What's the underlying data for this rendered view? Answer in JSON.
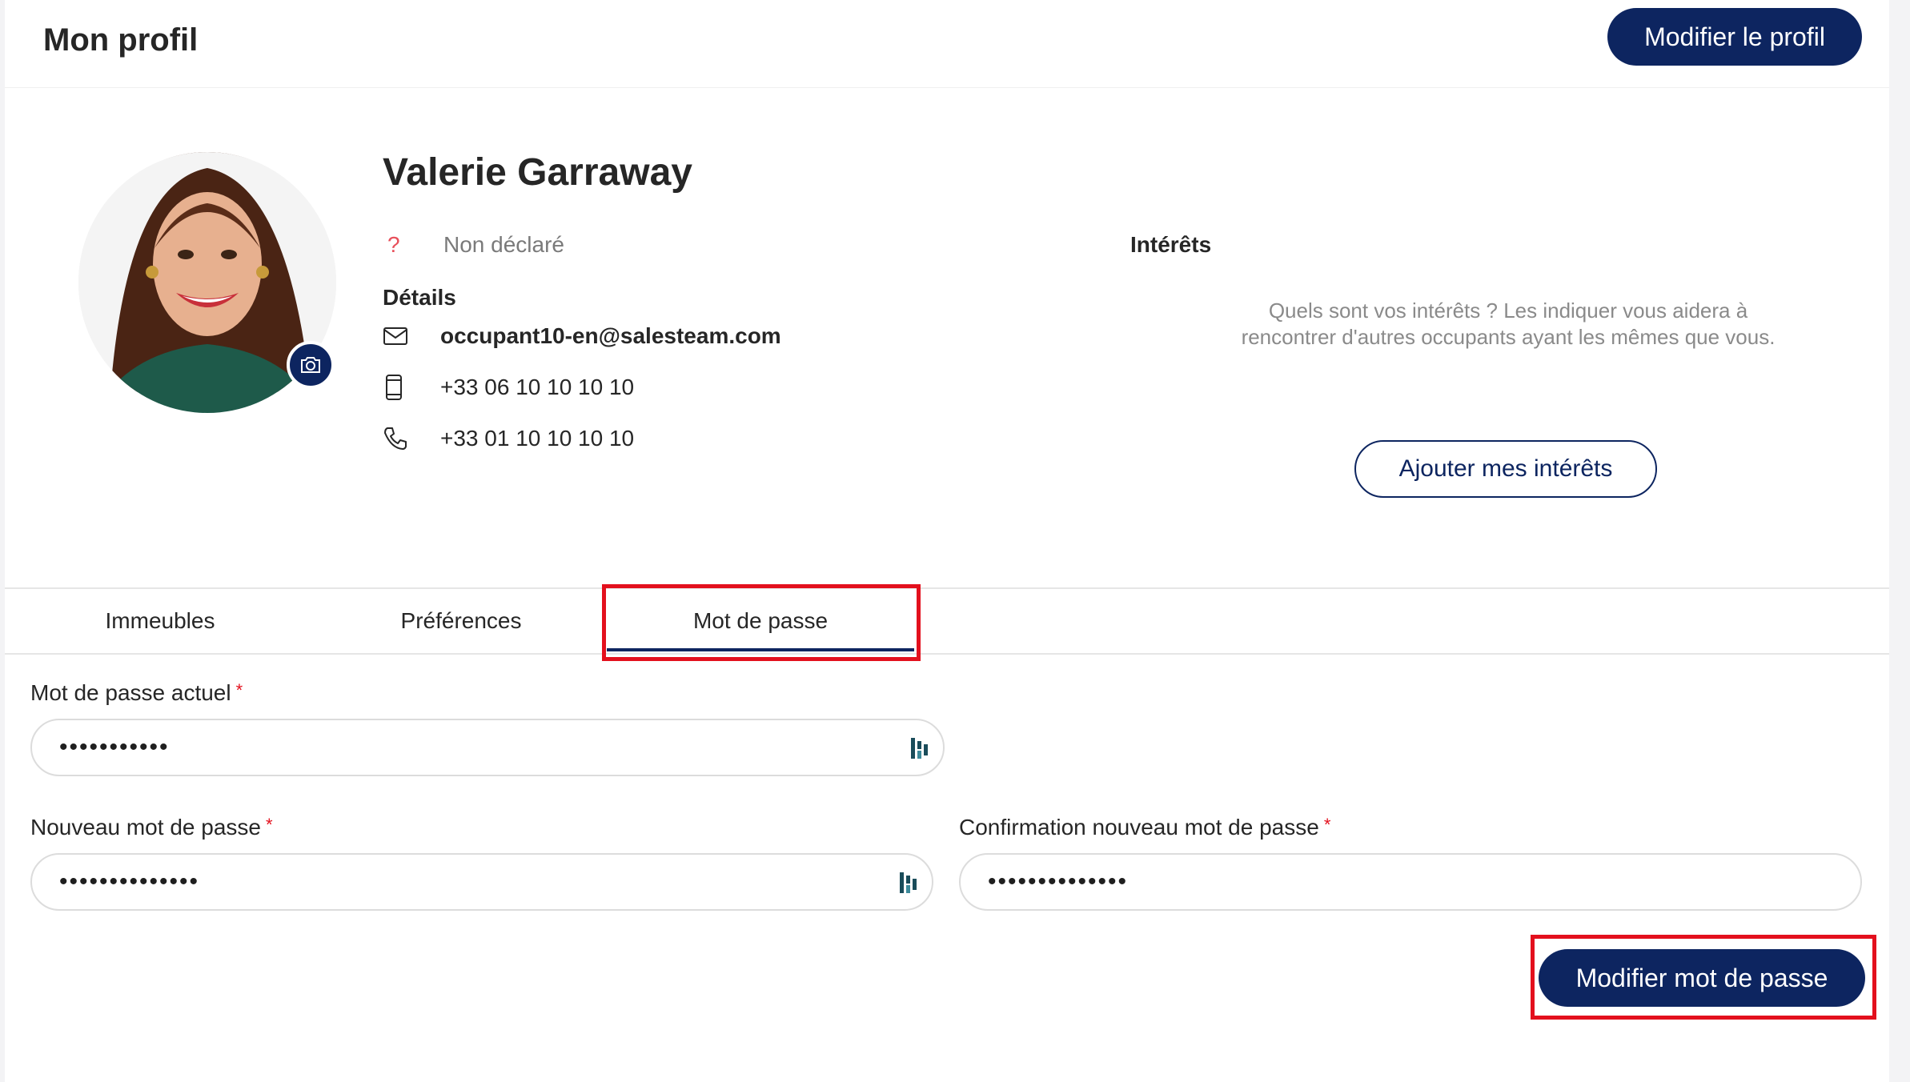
{
  "header": {
    "title": "Mon profil",
    "edit_button": "Modifier le profil"
  },
  "profile": {
    "name": "Valerie Garraway",
    "gender": "Non déclaré",
    "details_title": "Détails",
    "email": "occupant10-en@salesteam.com",
    "mobile": "+33 06 10 10 10 10",
    "phone": "+33 01 10 10 10 10"
  },
  "interests": {
    "title": "Intérêts",
    "description": "Quels sont vos intérêts ? Les indiquer vous aidera à rencontrer d'autres occupants ayant les mêmes que vous.",
    "add_button": "Ajouter mes intérêts"
  },
  "tabs": [
    {
      "label": "Immeubles",
      "active": false
    },
    {
      "label": "Préférences",
      "active": false
    },
    {
      "label": "Mot de passe",
      "active": true
    }
  ],
  "form": {
    "current_label": "Mot de passe actuel",
    "current_value": "•••••••••••",
    "new_label": "Nouveau mot de passe",
    "new_value": "••••••••••••••",
    "confirm_label": "Confirmation nouveau mot de passe",
    "confirm_value": "••••••••••••••",
    "required_mark": "*",
    "submit_button": "Modifier mot de passe"
  },
  "colors": {
    "primary": "#0d2560",
    "highlight": "#e3101d",
    "required": "#e3101d"
  },
  "icons": [
    "camera-icon",
    "question-icon",
    "mail-icon",
    "mobile-icon",
    "phone-icon",
    "password-manager-icon"
  ]
}
